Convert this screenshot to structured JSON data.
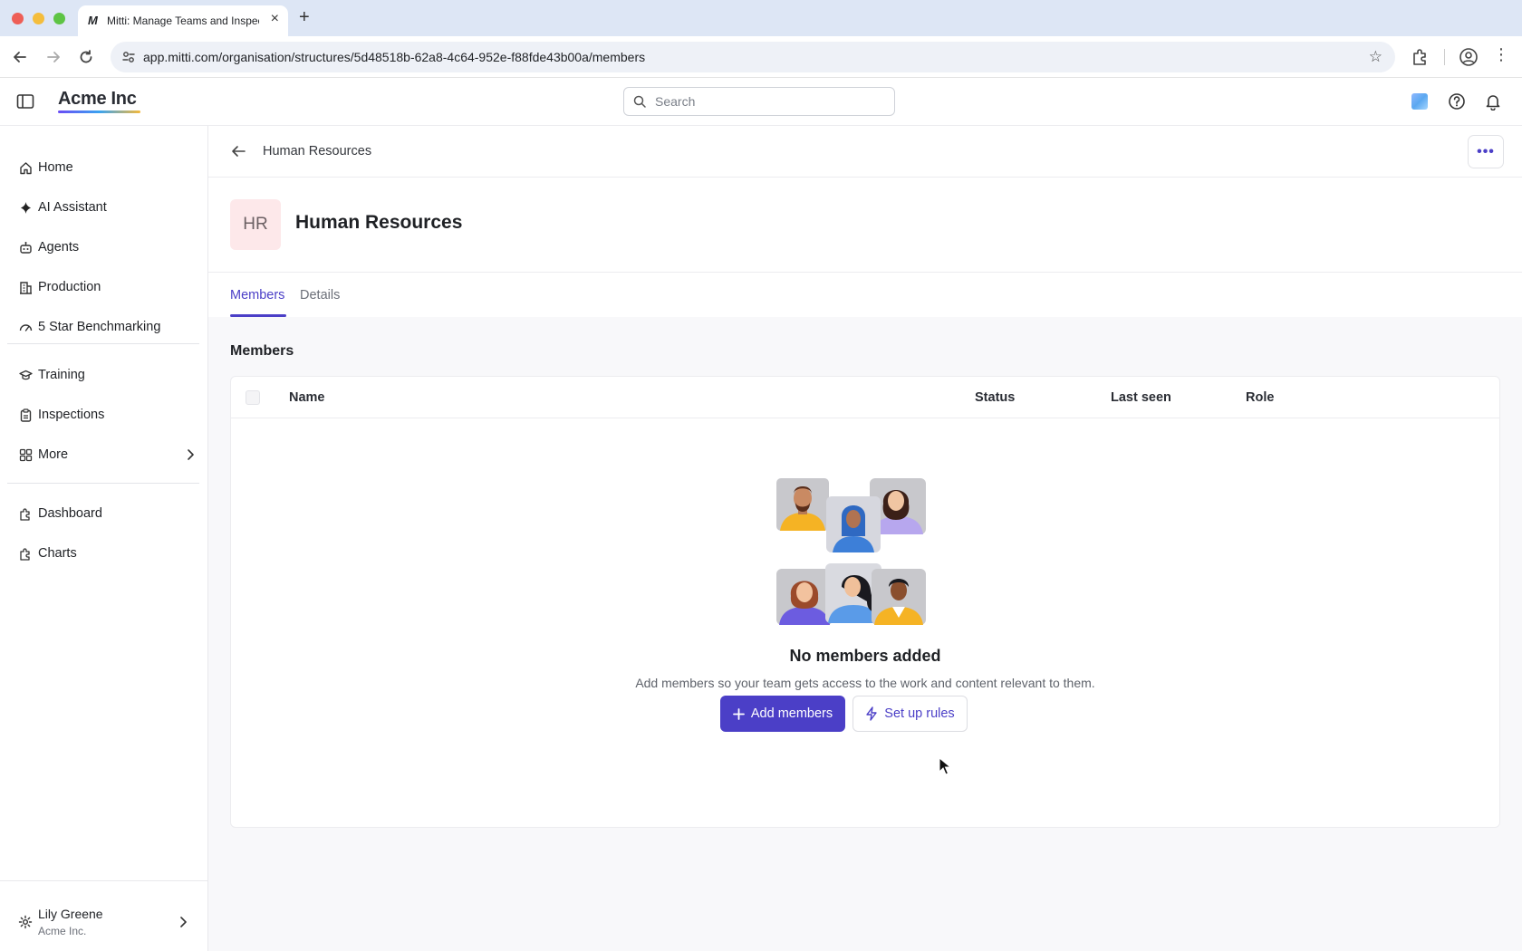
{
  "browser": {
    "tab_title": "Mitti: Manage Teams and Inspections",
    "tab_favicon": "M",
    "new_tab": "+",
    "url": "app.mitti.com/organisation/structures/5d48518b-62a8-4c64-952e-f88fde43b00a/members"
  },
  "header": {
    "brand": "Acme Inc",
    "search_placeholder": "Search"
  },
  "sidebar": {
    "items": [
      {
        "label": "Home",
        "icon": "home-icon"
      },
      {
        "label": "AI Assistant",
        "icon": "sparkle-icon"
      },
      {
        "label": "Agents",
        "icon": "robot-icon"
      },
      {
        "label": "Production",
        "icon": "building-icon"
      },
      {
        "label": "5 Star Benchmarking",
        "icon": "gauge-icon"
      },
      {
        "label": "Training",
        "icon": "graduation-cap-icon"
      },
      {
        "label": "Inspections",
        "icon": "clipboard-icon"
      },
      {
        "label": "More",
        "icon": "grid-icon"
      },
      {
        "label": "Dashboard",
        "icon": "puzzle-icon"
      },
      {
        "label": "Charts",
        "icon": "puzzle-icon"
      }
    ],
    "user": {
      "name": "Lily Greene",
      "org": "Acme Inc."
    }
  },
  "page": {
    "breadcrumb": "Human Resources",
    "badge": "HR",
    "title": "Human Resources",
    "tabs": [
      {
        "label": "Members",
        "active": true
      },
      {
        "label": "Details",
        "active": false
      }
    ],
    "section_title": "Members",
    "table": {
      "columns": [
        "Name",
        "Status",
        "Last seen",
        "Role"
      ],
      "rows": []
    },
    "empty_state": {
      "title": "No members added",
      "description": "Add members so your team gets access to the work and content relevant to them.",
      "primary_button": "Add members",
      "secondary_button": "Set up rules"
    }
  },
  "colors": {
    "accent": "#4b3fc7",
    "badge_bg": "#fde8ea"
  }
}
